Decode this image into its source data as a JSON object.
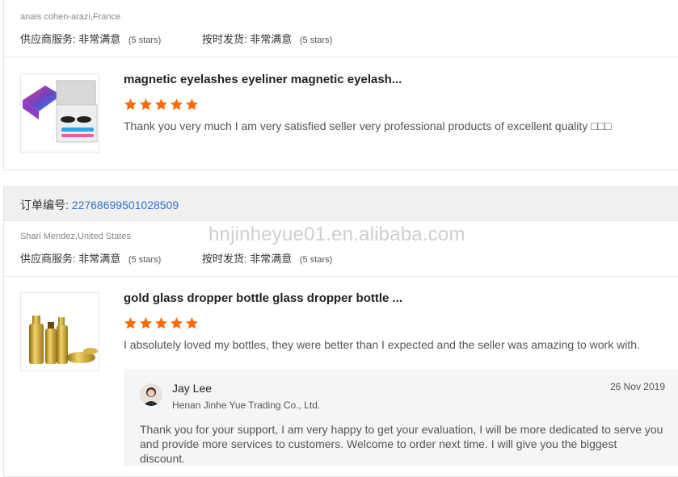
{
  "reviews": [
    {
      "buyer": "anais cohen-arazi,France",
      "ratings": {
        "service_label": "供应商服务:",
        "service_value": "非常满意",
        "service_stars": "(5 stars)",
        "shipping_label": "按时发货:",
        "shipping_value": "非常满意",
        "shipping_stars": "(5 stars)"
      },
      "product": {
        "title": "magnetic eyelashes eyeliner magnetic eyelash...",
        "rating": 5,
        "text": "Thank you very much I am very satisfied seller very professional products of excellent quality □□□",
        "thumbnail_icon": "eyelash-kit-image"
      }
    },
    {
      "order_label": "订单编号:",
      "order_number": "22768699501028509",
      "buyer": "Shari Mendez,United States",
      "ratings": {
        "service_label": "供应商服务:",
        "service_value": "非常满意",
        "service_stars": "(5 stars)",
        "shipping_label": "按时发货:",
        "shipping_value": "非常满意",
        "shipping_stars": "(5 stars)"
      },
      "product": {
        "title": "gold glass dropper bottle glass dropper bottle ...",
        "rating": 5,
        "text": "I absolutely loved my bottles, they were better than I expected and the seller was amazing to work with.",
        "thumbnail_icon": "gold-dropper-bottles-image"
      },
      "reply": {
        "name": "Jay Lee",
        "company": "Henan Jinhe Yue Trading Co., Ltd.",
        "date": "26 Nov 2019",
        "text": "Thank you for your support, I am very happy to get your evaluation, I will be more dedicated to serve you and provide more services to customers. Welcome to order next time. I will give you the biggest discount."
      }
    }
  ],
  "watermark": "hnjinheyue01.en.alibaba.com",
  "colors": {
    "star": "#ff6a00",
    "order_number": "#2f73c8"
  }
}
